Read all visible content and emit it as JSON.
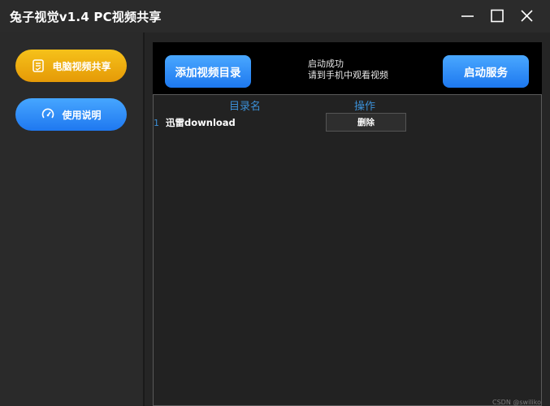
{
  "window": {
    "title": "兔子视觉v1.4 PC视频共享"
  },
  "sidebar": {
    "items": [
      {
        "label": "电脑视频共享",
        "icon": "document-list-icon",
        "color": "#f0a80f"
      },
      {
        "label": "使用说明",
        "icon": "gauge-icon",
        "color": "#2e8ef8"
      }
    ]
  },
  "toolbar": {
    "add_dir_label": "添加视频目录",
    "status_line1": "启动成功",
    "status_line2": "请到手机中观看视频",
    "start_label": "启动服务"
  },
  "table": {
    "columns": [
      "目录名",
      "操作"
    ],
    "rows": [
      {
        "index": "1",
        "name": "迅雷download",
        "action": "删除"
      }
    ]
  },
  "watermark": "CSDN @swiliko",
  "colors": {
    "accent_blue": "#2e8ef8",
    "accent_orange": "#f0a80f",
    "header_text": "#3b8fd6",
    "background": "#252525"
  }
}
